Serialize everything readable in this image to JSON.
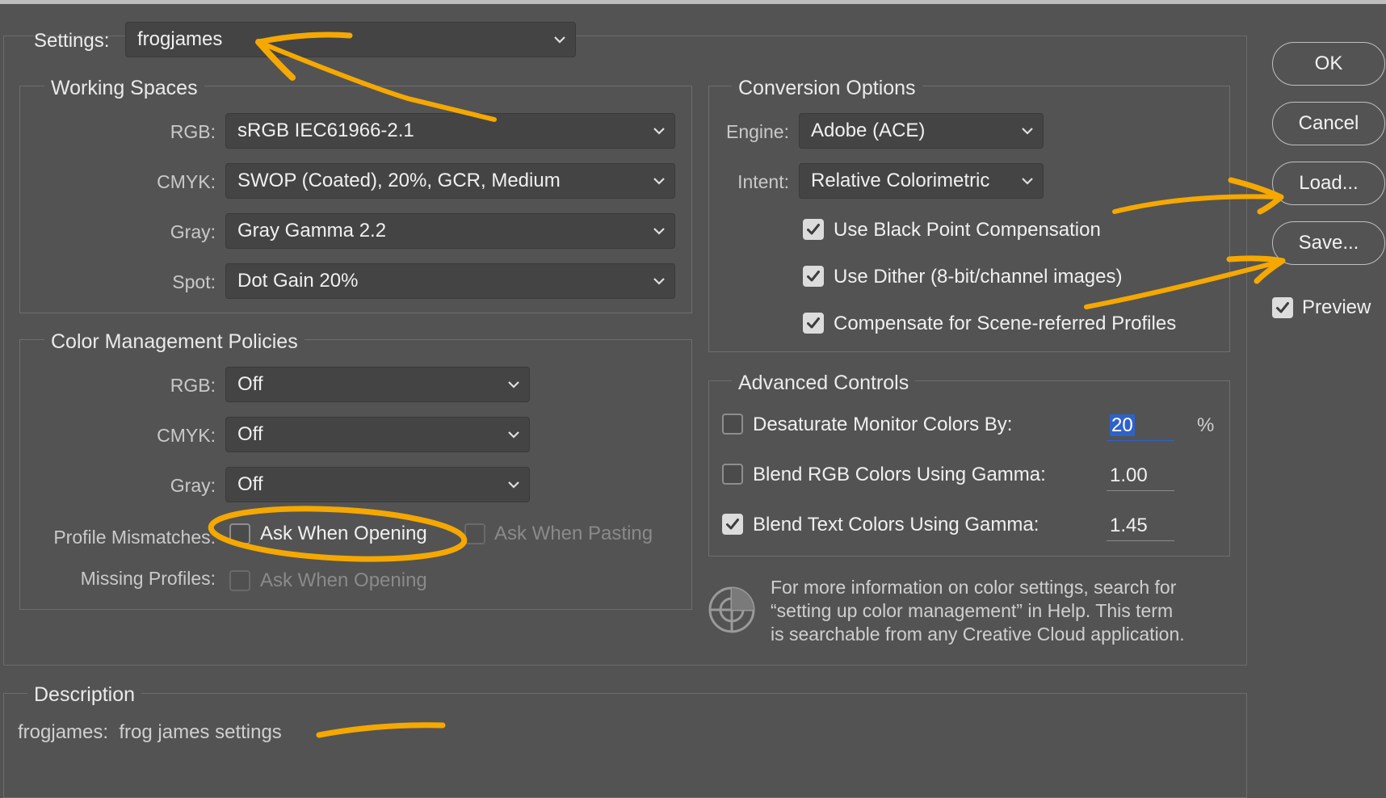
{
  "settings": {
    "label": "Settings:",
    "value": "frogjames"
  },
  "working_spaces": {
    "title": "Working Spaces",
    "rows": [
      {
        "label": "RGB:",
        "value": "sRGB IEC61966-2.1"
      },
      {
        "label": "CMYK:",
        "value": "SWOP (Coated), 20%, GCR, Medium"
      },
      {
        "label": "Gray:",
        "value": "Gray Gamma 2.2"
      },
      {
        "label": "Spot:",
        "value": "Dot Gain 20%"
      }
    ]
  },
  "policies": {
    "title": "Color Management Policies",
    "rows": [
      {
        "label": "RGB:",
        "value": "Off"
      },
      {
        "label": "CMYK:",
        "value": "Off"
      },
      {
        "label": "Gray:",
        "value": "Off"
      }
    ],
    "profile_mismatches": {
      "label": "Profile Mismatches:",
      "ask_opening": {
        "label": "Ask When Opening",
        "checked": false
      },
      "ask_pasting": {
        "label": "Ask When Pasting",
        "checked": false,
        "disabled": true
      }
    },
    "missing_profiles": {
      "label": "Missing Profiles:",
      "ask_opening": {
        "label": "Ask When Opening",
        "checked": false,
        "disabled": true
      }
    }
  },
  "conversion": {
    "title": "Conversion Options",
    "engine": {
      "label": "Engine:",
      "value": "Adobe (ACE)"
    },
    "intent": {
      "label": "Intent:",
      "value": "Relative Colorimetric"
    },
    "checks": [
      {
        "label": "Use Black Point Compensation",
        "checked": true
      },
      {
        "label": "Use Dither (8-bit/channel images)",
        "checked": true
      },
      {
        "label": "Compensate for Scene-referred Profiles",
        "checked": true
      }
    ]
  },
  "advanced": {
    "title": "Advanced Controls",
    "rows": [
      {
        "label": "Desaturate Monitor Colors By:",
        "checked": false,
        "value": "20",
        "unit": "%"
      },
      {
        "label": "Blend RGB Colors Using Gamma:",
        "checked": false,
        "value": "1.00"
      },
      {
        "label": "Blend Text Colors Using Gamma:",
        "checked": true,
        "value": "1.45"
      }
    ]
  },
  "info": {
    "lines": [
      "For more information on color settings, search for",
      "“setting up color management” in Help. This term",
      "is searchable from any Creative Cloud application."
    ]
  },
  "description": {
    "title": "Description",
    "text": "frogjames:  frog james settings"
  },
  "buttons": {
    "ok": "OK",
    "cancel": "Cancel",
    "load": "Load...",
    "save": "Save..."
  },
  "preview": {
    "label": "Preview",
    "checked": true
  },
  "colors": {
    "annotation": "#f5a800",
    "selection": "#2f62c9",
    "background": "#535353"
  }
}
